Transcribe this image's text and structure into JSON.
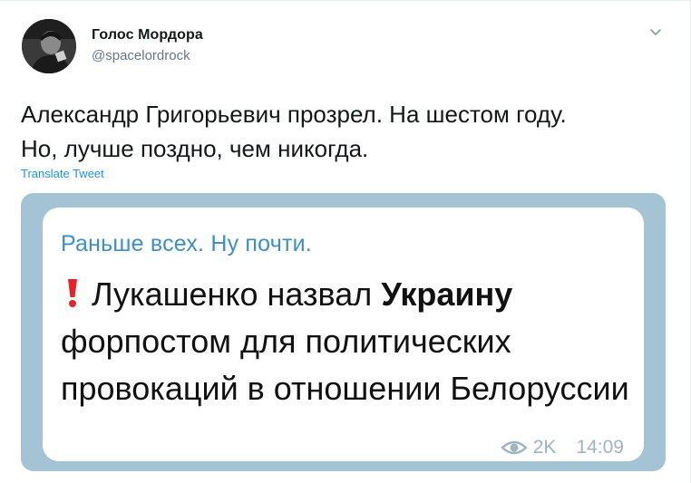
{
  "author": {
    "name": "Голос Мордора",
    "handle": "@spacelordrock",
    "avatar_icon": "avatar-photo"
  },
  "tweet": {
    "line1": "Александр Григорьевич прозрел. На шестом году.",
    "line2": "Но, лучше поздно, чем никогда.",
    "translate_label": "Translate Tweet",
    "menu_icon": "chevron-down-icon"
  },
  "media": {
    "title": "Раньше всех. Ну почти.",
    "text_before_bold": "Лукашенко назвал ",
    "text_bold": "Украину",
    "text_after_bold": " форпостом для политических провокаций в отношении Белоруссии",
    "views": "2K",
    "time": "14:09",
    "alert_icon": "exclamation-icon",
    "views_icon": "eye-icon"
  },
  "colors": {
    "link": "#1b95e0",
    "handle": "#657786",
    "channel_title": "#3d8fc4",
    "media_bg": "#a4c4d6",
    "alert": "#e0262b"
  }
}
